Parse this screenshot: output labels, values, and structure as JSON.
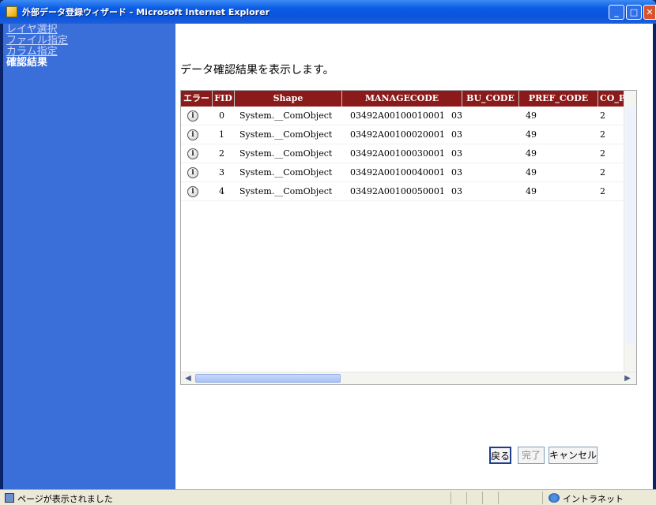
{
  "window": {
    "title": "外部データ登録ウィザード - Microsoft Internet Explorer",
    "minimize_symbol": "_",
    "maximize_symbol": "□",
    "close_symbol": "✕"
  },
  "sidebar": {
    "items": [
      {
        "label": "レイヤ選択",
        "state": "link"
      },
      {
        "label": "ファイル指定",
        "state": "link"
      },
      {
        "label": "カラム指定",
        "state": "link"
      },
      {
        "label": "確認結果",
        "state": "current"
      }
    ]
  },
  "main": {
    "message": "データ確認結果を表示します。"
  },
  "grid": {
    "columns": [
      "エラー",
      "FID",
      "Shape",
      "MANAGECODE",
      "BU_CODE",
      "PREF_CODE",
      "CO_P"
    ],
    "rows": [
      {
        "error_icon": "i",
        "fid": "0",
        "shape": "System.__ComObject",
        "managecode": "03492A00100010001",
        "bu_code": "03",
        "pref_code": "49",
        "co_p": "2"
      },
      {
        "error_icon": "i",
        "fid": "1",
        "shape": "System.__ComObject",
        "managecode": "03492A00100020001",
        "bu_code": "03",
        "pref_code": "49",
        "co_p": "2"
      },
      {
        "error_icon": "i",
        "fid": "2",
        "shape": "System.__ComObject",
        "managecode": "03492A00100030001",
        "bu_code": "03",
        "pref_code": "49",
        "co_p": "2"
      },
      {
        "error_icon": "i",
        "fid": "3",
        "shape": "System.__ComObject",
        "managecode": "03492A00100040001",
        "bu_code": "03",
        "pref_code": "49",
        "co_p": "2"
      },
      {
        "error_icon": "i",
        "fid": "4",
        "shape": "System.__ComObject",
        "managecode": "03492A00100050001",
        "bu_code": "03",
        "pref_code": "49",
        "co_p": "2"
      }
    ]
  },
  "buttons": {
    "back": "戻る",
    "finish": "完了",
    "cancel": "キャンセル"
  },
  "statusbar": {
    "text": "ページが表示されました",
    "zone": "イントラネット"
  },
  "colors": {
    "title_bar": "#0a55dc",
    "sidebar": "#3a6ed8",
    "grid_header": "#8b1a1a"
  }
}
